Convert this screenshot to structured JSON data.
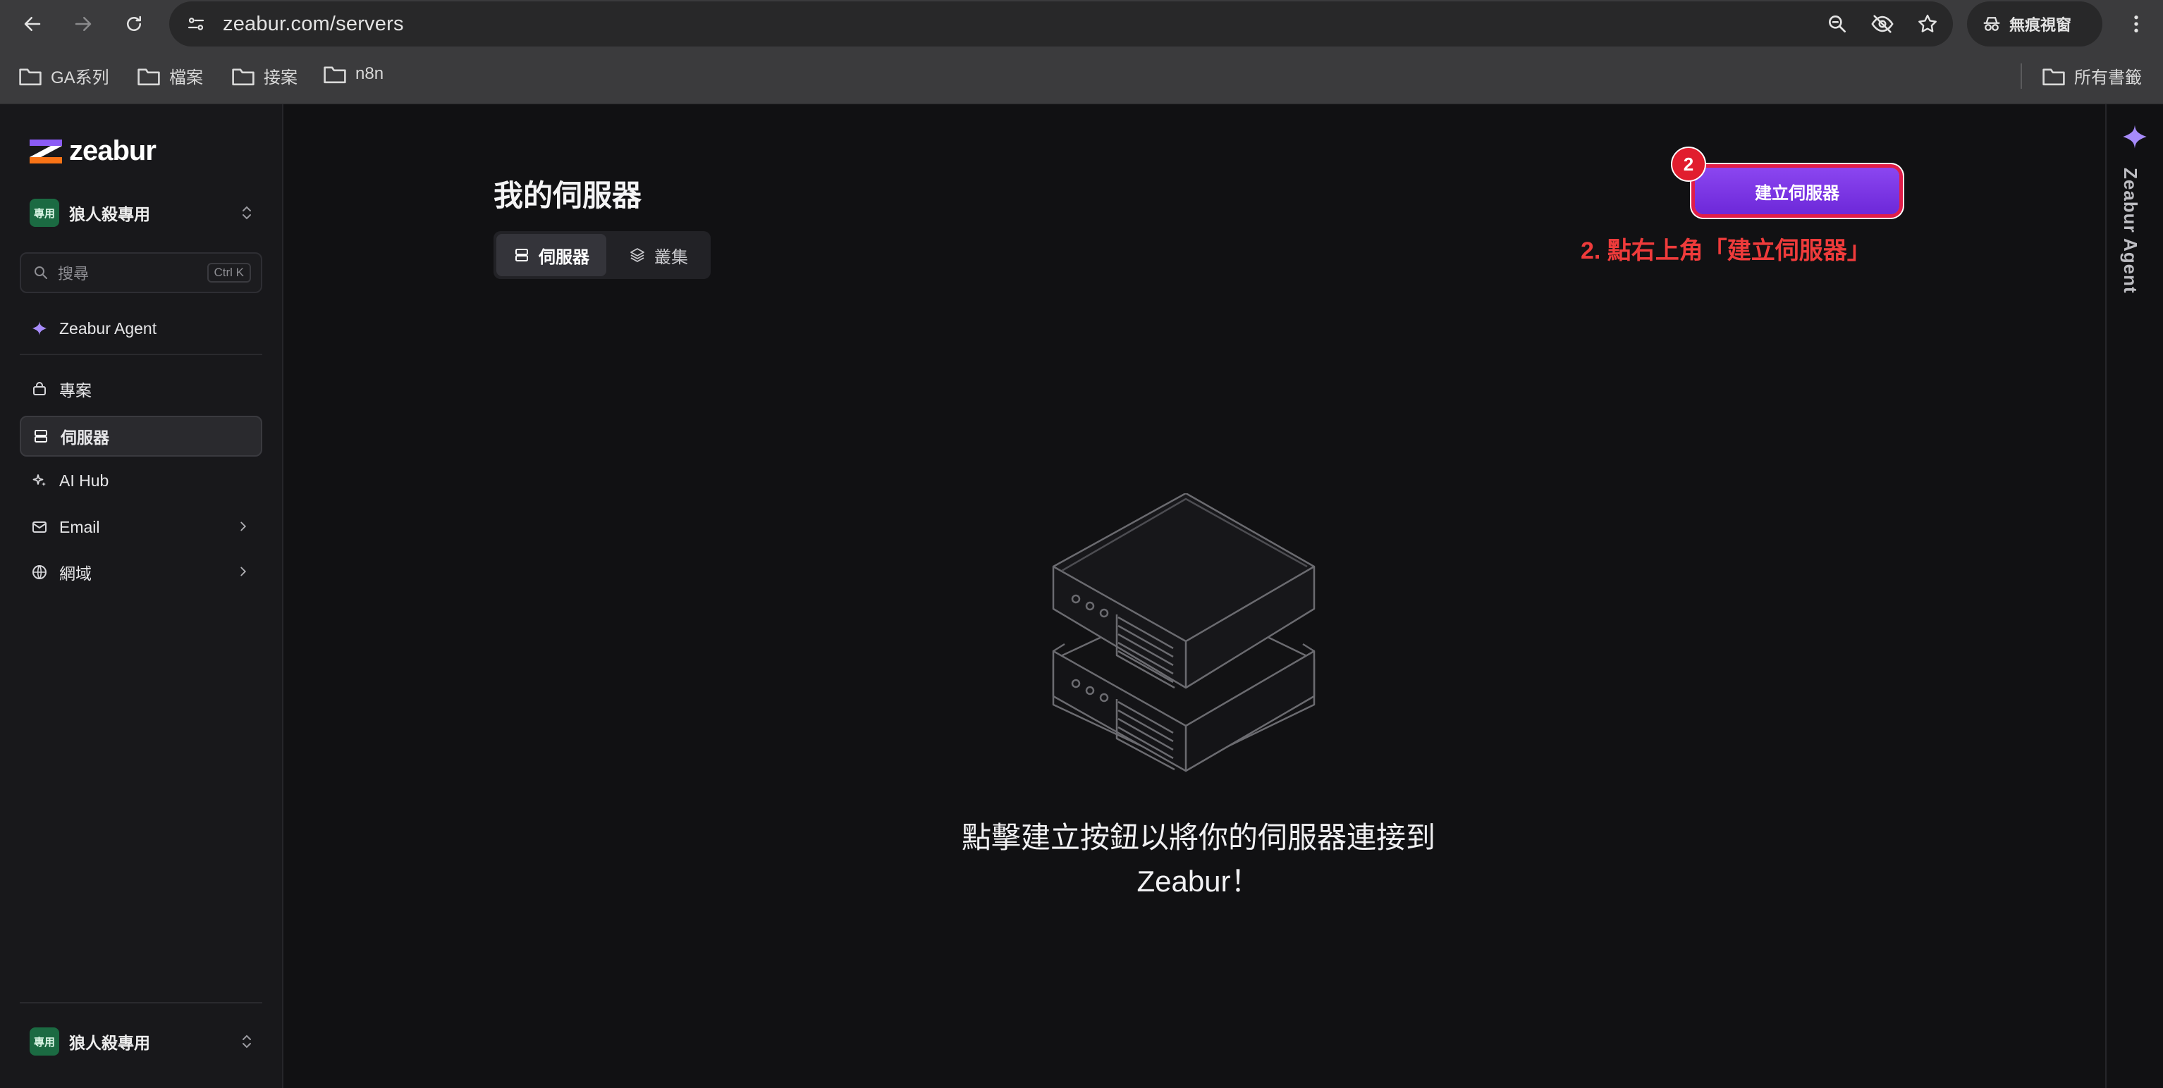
{
  "browser": {
    "url": "zeabur.com/servers",
    "incognito_label": "無痕視窗",
    "bookmarks": [
      "GA系列",
      "檔案",
      "接案",
      "n8n"
    ],
    "all_bookmarks_label": "所有書籤"
  },
  "sidebar": {
    "brand": "zeabur",
    "workspace_badge": "專用",
    "workspace_name": "狼人殺專用",
    "search_placeholder": "搜尋",
    "search_shortcut": "Ctrl K",
    "agent_label": "Zeabur Agent",
    "items": [
      {
        "label": "專案",
        "icon": "bag-icon"
      },
      {
        "label": "伺服器",
        "icon": "server-icon",
        "active": true
      },
      {
        "label": "AI Hub",
        "icon": "sparkle-icon"
      },
      {
        "label": "Email",
        "icon": "mail-icon",
        "has_submenu": true
      },
      {
        "label": "網域",
        "icon": "globe-icon",
        "has_submenu": true
      }
    ],
    "footer_workspace_badge": "專用",
    "footer_workspace_name": "狼人殺專用"
  },
  "main": {
    "title": "我的伺服器",
    "tabs": [
      {
        "label": "伺服器",
        "active": true
      },
      {
        "label": "叢集",
        "active": false
      }
    ],
    "create_button_label": "建立伺服器",
    "step_badge": "2",
    "annotation": "2. 點右上角「建立伺服器」",
    "empty_line1": "點擊建立按鈕以將你的伺服器連接到",
    "empty_line2": "Zeabur！"
  },
  "right_rail": {
    "label": "Zeabur Agent"
  },
  "colors": {
    "accent_purple": "#7c3aed",
    "annotation_red": "#ef3b3b",
    "workspace_green": "#1b6a42"
  }
}
